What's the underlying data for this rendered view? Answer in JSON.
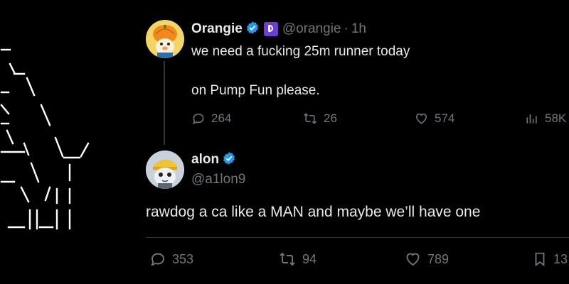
{
  "tweet1": {
    "display_name": "Orangie",
    "handle": "@orangie",
    "separator": "·",
    "time": "1h",
    "line1": "we need a fucking 25m runner today",
    "line2": "on Pump Fun please.",
    "replies": "264",
    "retweets": "26",
    "likes": "574",
    "views": "58K",
    "avatar_icon": "pumpkin-hat-avatar",
    "badge_icon": "verified-icon",
    "brand_icon": "pump-fun-icon"
  },
  "tweet2": {
    "display_name": "alon",
    "handle": "@a1lon9",
    "text": "rawdog a ca like a MAN and maybe we’ll have one",
    "replies": "353",
    "retweets": "94",
    "likes": "789",
    "bookmarks": "13",
    "avatar_icon": "cat-hat-avatar",
    "badge_icon": "verified-icon"
  },
  "colors": {
    "background": "#000000",
    "text": "#e7e9ea",
    "muted": "#71767b",
    "verified": "#1d9bf0",
    "thread_line": "#333639"
  }
}
